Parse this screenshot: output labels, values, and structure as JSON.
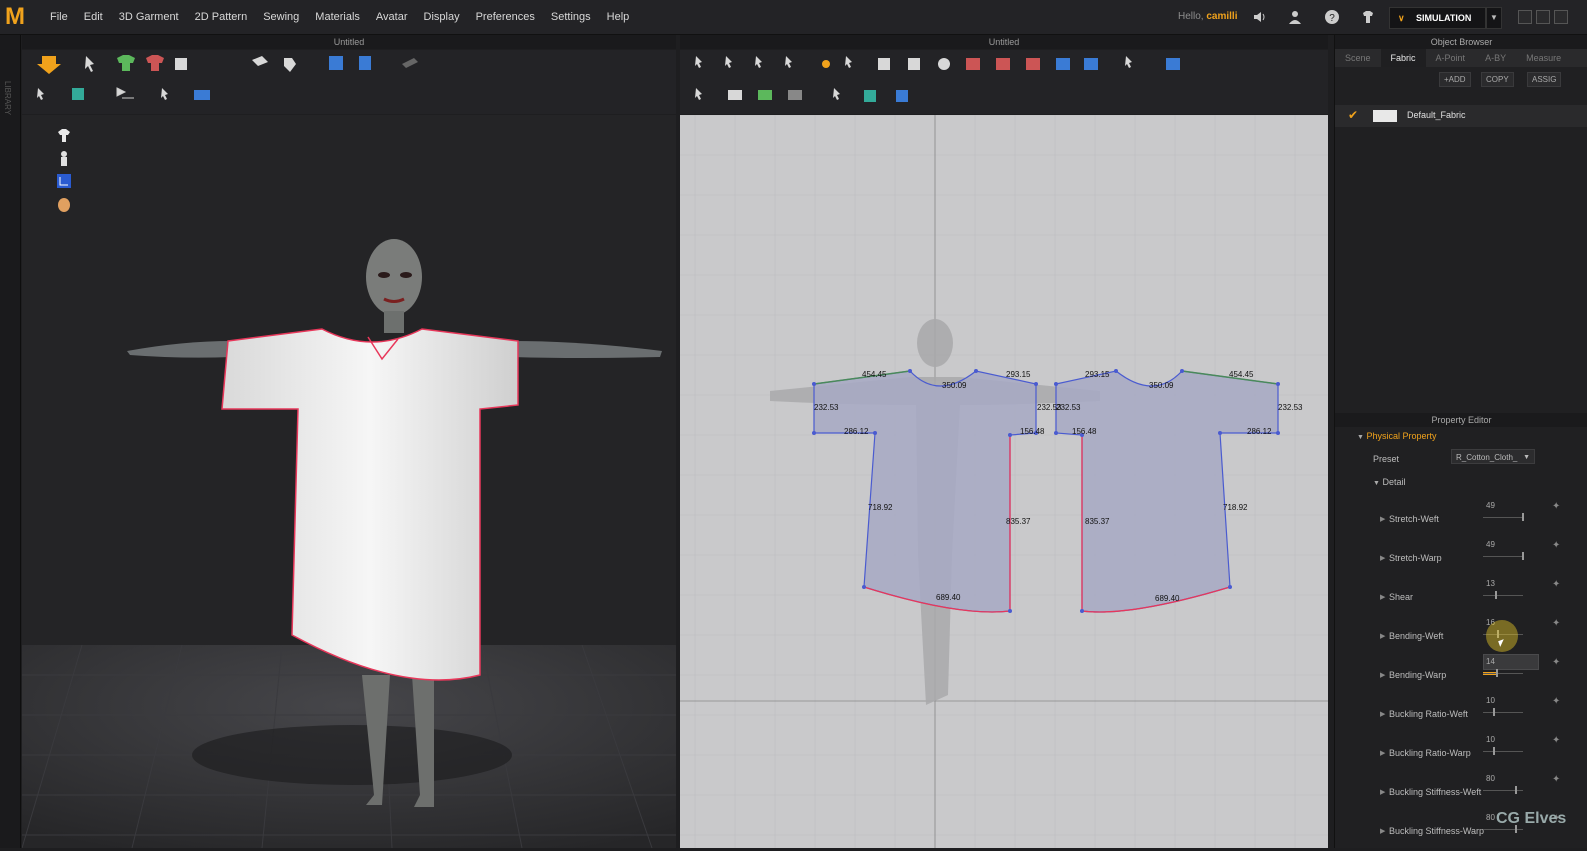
{
  "app": {
    "logo": "M"
  },
  "menu": [
    "File",
    "Edit",
    "3D Garment",
    "2D Pattern",
    "Sewing",
    "Materials",
    "Avatar",
    "Display",
    "Preferences",
    "Settings",
    "Help"
  ],
  "user": {
    "hello": "Hello,",
    "name": "camilli"
  },
  "mode": {
    "label": "SIMULATION"
  },
  "sidebar": {
    "library_label": "LIBRARY"
  },
  "views": {
    "left_title": "Untitled",
    "right_title": "Untitled"
  },
  "pattern": {
    "left_piece": [
      "454.45",
      "293.15",
      "350.09",
      "232.53",
      "232.53",
      "286.12",
      "156.48",
      "718.92",
      "835.37",
      "689.40"
    ],
    "right_piece": [
      "293.15",
      "350.09",
      "454.45",
      "232.53",
      "232.53",
      "156.48",
      "286.12",
      "835.37",
      "718.92",
      "689.40"
    ]
  },
  "object_browser": {
    "title": "Object Browser",
    "tabs": [
      "Scene",
      "Fabric",
      "A-Point",
      "A-BY",
      "Measure"
    ],
    "active_tab": "Fabric",
    "actions": [
      "+ADD",
      "COPY",
      "ASSIG"
    ],
    "fabrics": [
      "Default_Fabric"
    ]
  },
  "property_editor": {
    "title": "Property Editor",
    "section": "Physical Property",
    "preset_label": "Preset",
    "preset_value": "R_Cotton_Cloth_",
    "detail_label": "Detail",
    "properties": [
      {
        "label": "Stretch-Weft",
        "value": "49",
        "level": 0.98
      },
      {
        "label": "Stretch-Warp",
        "value": "49",
        "level": 0.98
      },
      {
        "label": "Shear",
        "value": "13",
        "level": 0.3
      },
      {
        "label": "Bending-Weft",
        "value": "16",
        "level": 0.35
      },
      {
        "label": "Bending-Warp",
        "value": "14",
        "level": 0.32
      },
      {
        "label": "Buckling Ratio-Weft",
        "value": "10",
        "level": 0.25
      },
      {
        "label": "Buckling Ratio-Warp",
        "value": "10",
        "level": 0.25
      },
      {
        "label": "Buckling Stiffness-Weft",
        "value": "80",
        "level": 0.8
      },
      {
        "label": "Buckling Stiffness-Warp",
        "value": "80",
        "level": 0.8
      }
    ]
  },
  "watermark": "CG Elves",
  "colors": {
    "accent": "#f0a21c",
    "seam": "#e8375a",
    "pattern_fill": "#a7a9c4",
    "outline_blue": "#4a5bd0"
  }
}
